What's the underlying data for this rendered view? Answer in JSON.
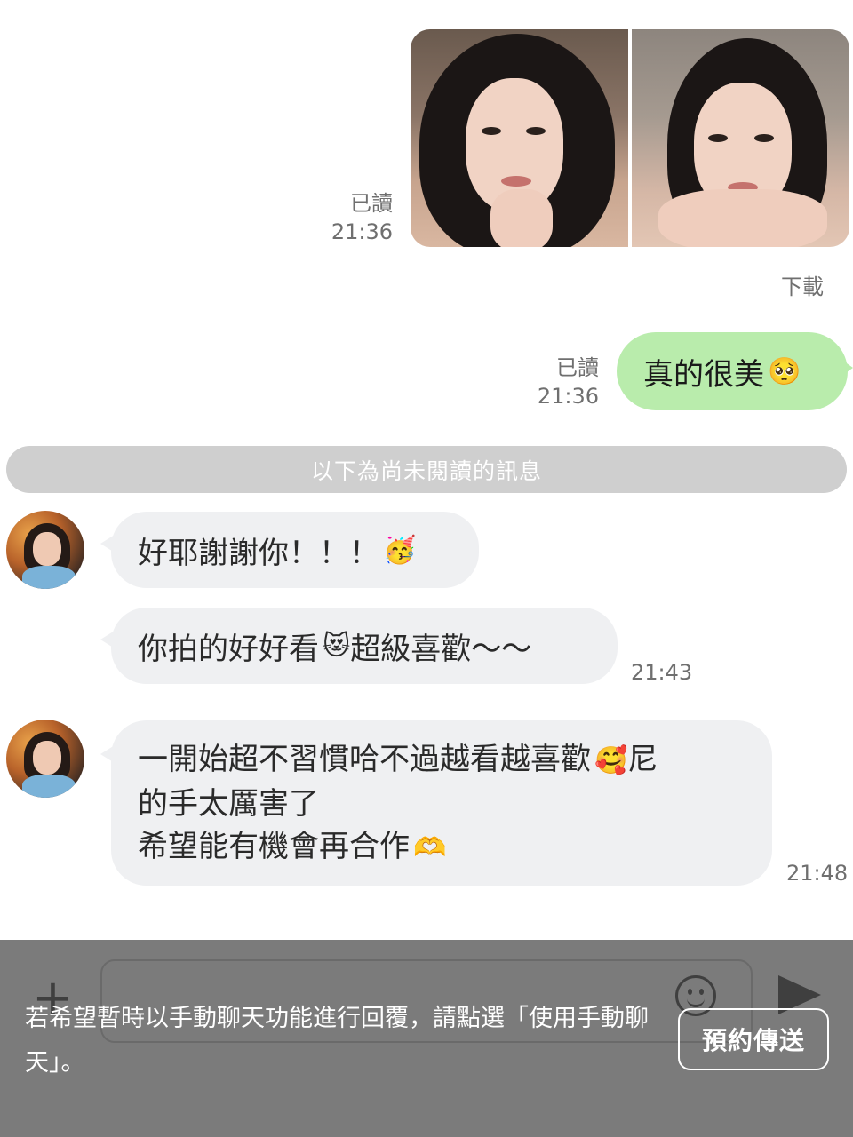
{
  "messages": {
    "photo_read_status": "已讀",
    "photo_time": "21:36",
    "download_label": "下載",
    "outgoing_text": "真的很美",
    "outgoing_emoji": "🥺",
    "outgoing_read_status": "已讀",
    "outgoing_time": "21:36",
    "unread_divider": "以下為尚未閱讀的訊息",
    "incoming1_text": "好耶謝謝你！！！",
    "incoming1_emoji": "🥳",
    "incoming2_text": "你拍的好好看",
    "incoming2_emoji": "😻",
    "incoming2_text_after": "超級喜歡～～",
    "incoming2_time": "21:43",
    "incoming3_line1": "一開始超不習慣哈不過越看越喜歡",
    "incoming3_emoji": "🥰",
    "incoming3_line1_after": "尼",
    "incoming3_line2": "的手太厲害了",
    "incoming3_line3": "希望能有機會再合作",
    "incoming3_emoji2": "🫶",
    "incoming3_time": "21:48"
  },
  "composer": {
    "plus_icon": "+",
    "notice_text": "若希望暫時以手動聊天功能進行回覆，請點選「使用手動聊天」。",
    "reserve_button": "預約傳送"
  }
}
